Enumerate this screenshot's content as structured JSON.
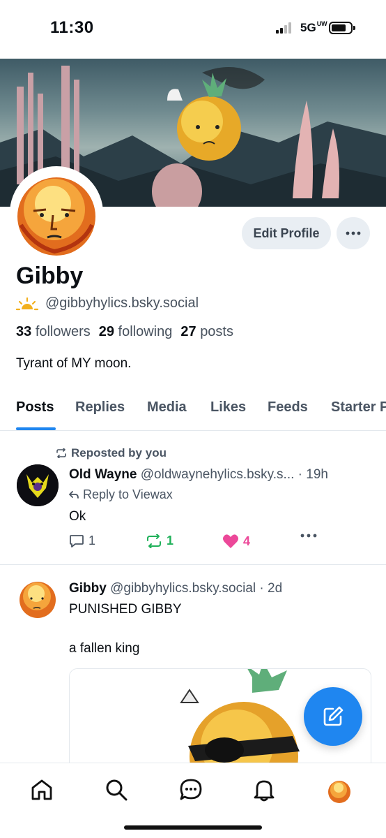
{
  "status_bar": {
    "time": "11:30",
    "network": "5G",
    "network_suffix": "UW"
  },
  "profile": {
    "edit_label": "Edit Profile",
    "display_name": "Gibby",
    "handle": "@gibbyhylics.bsky.social",
    "followers_count": "33",
    "followers_label": "followers",
    "following_count": "29",
    "following_label": "following",
    "posts_count": "27",
    "posts_label": "posts",
    "bio": "Tyrant of MY moon."
  },
  "tabs": [
    "Posts",
    "Replies",
    "Media",
    "Likes",
    "Feeds",
    "Starter Packs"
  ],
  "active_tab": "Posts",
  "feed": [
    {
      "repost_label": "Reposted by you",
      "author": "Old Wayne",
      "handle": "@oldwaynehylics.bsky.s...",
      "time": "· 19h",
      "reply_to": "Reply to Viewax",
      "text": "Ok",
      "replies": "1",
      "reposts": "1",
      "likes": "4"
    },
    {
      "author": "Gibby",
      "handle": "@gibbyhylics.bsky.social",
      "time": "· 2d",
      "text_line1": "PUNISHED GIBBY",
      "text_line2": "a fallen king"
    }
  ],
  "nav": [
    "home-icon",
    "search-icon",
    "chat-icon",
    "bell-icon",
    "profile-avatar"
  ],
  "colors": {
    "accent": "#1f86f0",
    "repost_green": "#20b15a",
    "like_pink": "#ec4899"
  }
}
